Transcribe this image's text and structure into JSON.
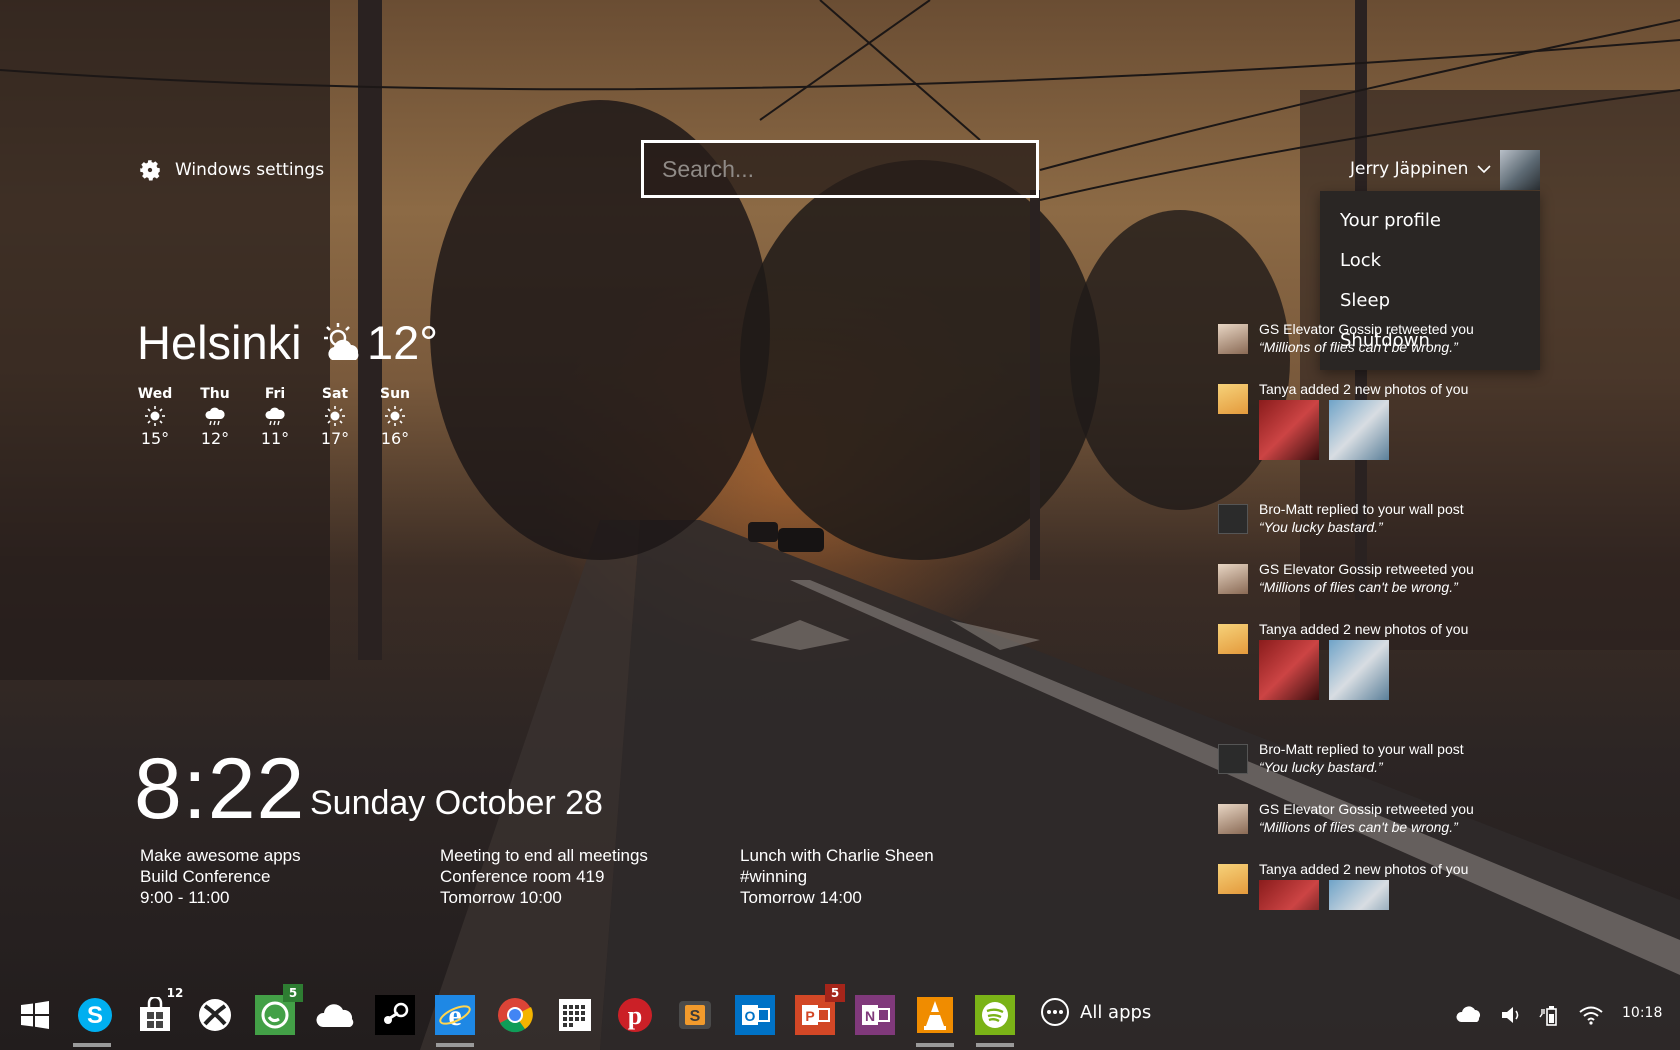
{
  "header": {
    "settings_label": "Windows settings",
    "search_placeholder": "Search...",
    "user_name": "Jerry Jäppinen"
  },
  "user_menu": {
    "items": [
      "Your profile",
      "Lock",
      "Sleep",
      "Shutdown"
    ]
  },
  "weather": {
    "city": "Helsinki",
    "current_temp": "12°",
    "current_icon": "partly-cloudy-icon",
    "forecast": [
      {
        "day": "Wed",
        "temp": "15°",
        "icon": "sun-icon"
      },
      {
        "day": "Thu",
        "temp": "12°",
        "icon": "rain-cloud-icon"
      },
      {
        "day": "Fri",
        "temp": "11°",
        "icon": "rain-cloud-icon"
      },
      {
        "day": "Sat",
        "temp": "17°",
        "icon": "sun-icon"
      },
      {
        "day": "Sun",
        "temp": "16°",
        "icon": "sun-icon"
      }
    ]
  },
  "clock": {
    "time": "8:22",
    "date": "Sunday October 28"
  },
  "agenda": [
    {
      "title": "Make awesome apps",
      "place": "Build Conference",
      "time": "9:00 - 11:00"
    },
    {
      "title": "Meeting to end all meetings",
      "place": "Conference room 419",
      "time": "Tomorrow 10:00"
    },
    {
      "title": "Lunch with Charlie Sheen",
      "place": "#winning",
      "time": "Tomorrow 14:00"
    }
  ],
  "feed": [
    {
      "text": "GS Elevator Gossip retweeted you",
      "quote": "“Millions of flies can't be wrong.”",
      "avatar": "man-avatar"
    },
    {
      "text": "Tanya added 2 new photos of you",
      "avatar": "tanya-avatar",
      "photos": 2
    },
    {
      "text": "Bro-Matt replied to your wall post",
      "quote": "“You lucky bastard.”",
      "avatar": "brand-avatar"
    },
    {
      "text": "GS Elevator Gossip retweeted you",
      "quote": "“Millions of flies can't be wrong.”",
      "avatar": "man-avatar"
    },
    {
      "text": "Tanya added 2 new photos of you",
      "avatar": "tanya-avatar",
      "photos": 2
    },
    {
      "text": "Bro-Matt replied to your wall post",
      "quote": "“You lucky bastard.”",
      "avatar": "brand-avatar"
    },
    {
      "text": "GS Elevator Gossip retweeted you",
      "quote": "“Millions of flies can't be wrong.”",
      "avatar": "man-avatar"
    },
    {
      "text": "Tanya added 2 new photos of you",
      "avatar": "tanya-avatar",
      "photos": 2
    }
  ],
  "taskbar": {
    "apps": [
      {
        "name": "windows-start-icon"
      },
      {
        "name": "skype-icon"
      },
      {
        "name": "store-icon",
        "badge": "12"
      },
      {
        "name": "xbox-icon"
      },
      {
        "name": "whatsapp-icon",
        "badge": "5"
      },
      {
        "name": "onedrive-icon"
      },
      {
        "name": "steam-icon"
      },
      {
        "name": "internet-explorer-icon"
      },
      {
        "name": "chrome-icon"
      },
      {
        "name": "calendar-grid-icon"
      },
      {
        "name": "pinterest-icon"
      },
      {
        "name": "sublime-text-icon"
      },
      {
        "name": "outlook-icon"
      },
      {
        "name": "powerpoint-icon",
        "badge": "5"
      },
      {
        "name": "onenote-icon"
      },
      {
        "name": "vlc-icon"
      },
      {
        "name": "spotify-icon"
      }
    ],
    "all_apps_label": "All apps",
    "tray_icons": [
      "cloud-sync-icon",
      "volume-icon",
      "battery-icon",
      "wifi-icon"
    ],
    "clock": "10:18"
  },
  "colors": {
    "skype": "#00aff0",
    "whatsapp": "#43a047",
    "ie": "#1e88e5",
    "pinterest": "#cb2027",
    "outlook": "#0072c6",
    "powerpoint": "#d24726",
    "onenote": "#80397b",
    "vlc": "#f08c00",
    "spotify": "#7ab317"
  }
}
